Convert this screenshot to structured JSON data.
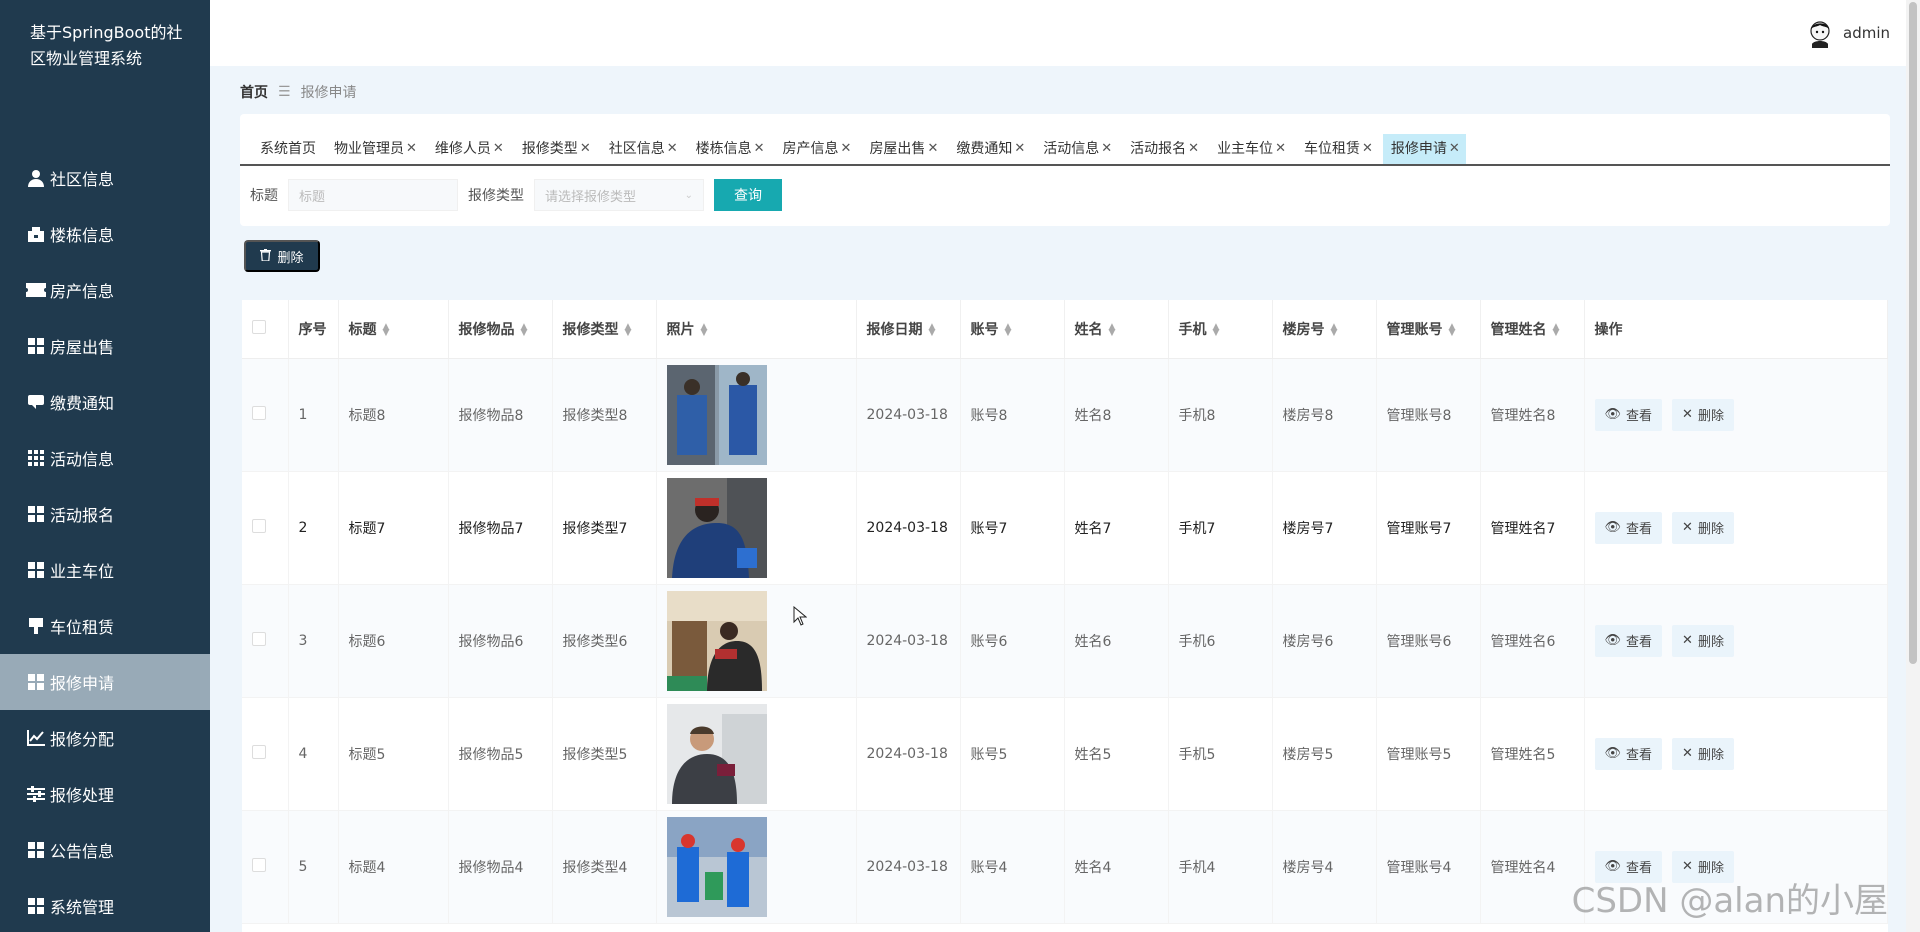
{
  "app": {
    "title": "基于SpringBoot的社区物业管理系统"
  },
  "sidebar": {
    "items": [
      {
        "label": "社区信息",
        "icon": "user-icon"
      },
      {
        "label": "楼栋信息",
        "icon": "building-icon"
      },
      {
        "label": "房产信息",
        "icon": "ticket-icon"
      },
      {
        "label": "房屋出售",
        "icon": "grid-icon"
      },
      {
        "label": "缴费通知",
        "icon": "message-icon"
      },
      {
        "label": "活动信息",
        "icon": "apps-icon"
      },
      {
        "label": "活动报名",
        "icon": "grid-icon"
      },
      {
        "label": "业主车位",
        "icon": "grid-icon"
      },
      {
        "label": "车位租赁",
        "icon": "flag-icon"
      },
      {
        "label": "报修申请",
        "icon": "grid-icon"
      },
      {
        "label": "报修分配",
        "icon": "chart-icon"
      },
      {
        "label": "报修处理",
        "icon": "sliders-icon"
      },
      {
        "label": "公告信息",
        "icon": "grid-icon"
      },
      {
        "label": "系统管理",
        "icon": "grid-icon"
      }
    ],
    "active_index": 9
  },
  "header": {
    "username": "admin"
  },
  "breadcrumb": {
    "home": "首页",
    "separator": "☰",
    "current": "报修申请"
  },
  "tabs": [
    {
      "label": "系统首页",
      "closable": false
    },
    {
      "label": "物业管理员",
      "closable": true
    },
    {
      "label": "维修人员",
      "closable": true
    },
    {
      "label": "报修类型",
      "closable": true
    },
    {
      "label": "社区信息",
      "closable": true
    },
    {
      "label": "楼栋信息",
      "closable": true
    },
    {
      "label": "房产信息",
      "closable": true
    },
    {
      "label": "房屋出售",
      "closable": true
    },
    {
      "label": "缴费通知",
      "closable": true
    },
    {
      "label": "活动信息",
      "closable": true
    },
    {
      "label": "活动报名",
      "closable": true
    },
    {
      "label": "业主车位",
      "closable": true
    },
    {
      "label": "车位租赁",
      "closable": true
    },
    {
      "label": "报修申请",
      "closable": true,
      "active": true
    }
  ],
  "search": {
    "title_label": "标题",
    "title_placeholder": "标题",
    "type_label": "报修类型",
    "type_placeholder": "请选择报修类型",
    "query_label": "查询"
  },
  "toolbar": {
    "delete_label": "删除"
  },
  "table": {
    "columns": [
      "序号",
      "标题",
      "报修物品",
      "报修类型",
      "照片",
      "报修日期",
      "账号",
      "姓名",
      "手机",
      "楼房号",
      "管理账号",
      "管理姓名",
      "操作"
    ],
    "view_label": "查看",
    "delete_label": "删除",
    "rows": [
      {
        "no": "1",
        "title": "标题8",
        "item": "报修物品8",
        "type": "报修类型8",
        "date": "2024-03-18",
        "account": "账号8",
        "name": "姓名8",
        "phone": "手机8",
        "room": "楼房号8",
        "mgr_account": "管理账号8",
        "mgr_name": "管理姓名8"
      },
      {
        "no": "2",
        "title": "标题7",
        "item": "报修物品7",
        "type": "报修类型7",
        "date": "2024-03-18",
        "account": "账号7",
        "name": "姓名7",
        "phone": "手机7",
        "room": "楼房号7",
        "mgr_account": "管理账号7",
        "mgr_name": "管理姓名7"
      },
      {
        "no": "3",
        "title": "标题6",
        "item": "报修物品6",
        "type": "报修类型6",
        "date": "2024-03-18",
        "account": "账号6",
        "name": "姓名6",
        "phone": "手机6",
        "room": "楼房号6",
        "mgr_account": "管理账号6",
        "mgr_name": "管理姓名6"
      },
      {
        "no": "4",
        "title": "标题5",
        "item": "报修物品5",
        "type": "报修类型5",
        "date": "2024-03-18",
        "account": "账号5",
        "name": "姓名5",
        "phone": "手机5",
        "room": "楼房号5",
        "mgr_account": "管理账号5",
        "mgr_name": "管理姓名5"
      },
      {
        "no": "5",
        "title": "标题4",
        "item": "报修物品4",
        "type": "报修类型4",
        "date": "2024-03-18",
        "account": "账号4",
        "name": "姓名4",
        "phone": "手机4",
        "room": "楼房号4",
        "mgr_account": "管理账号4",
        "mgr_name": "管理姓名4"
      }
    ]
  },
  "watermark": "CSDN @alan的小屋",
  "colors": {
    "sidebar_bg": "#203a4e",
    "sidebar_active": "#98aab7",
    "accent": "#17a9b0",
    "tab_active": "#c6ecf9"
  }
}
